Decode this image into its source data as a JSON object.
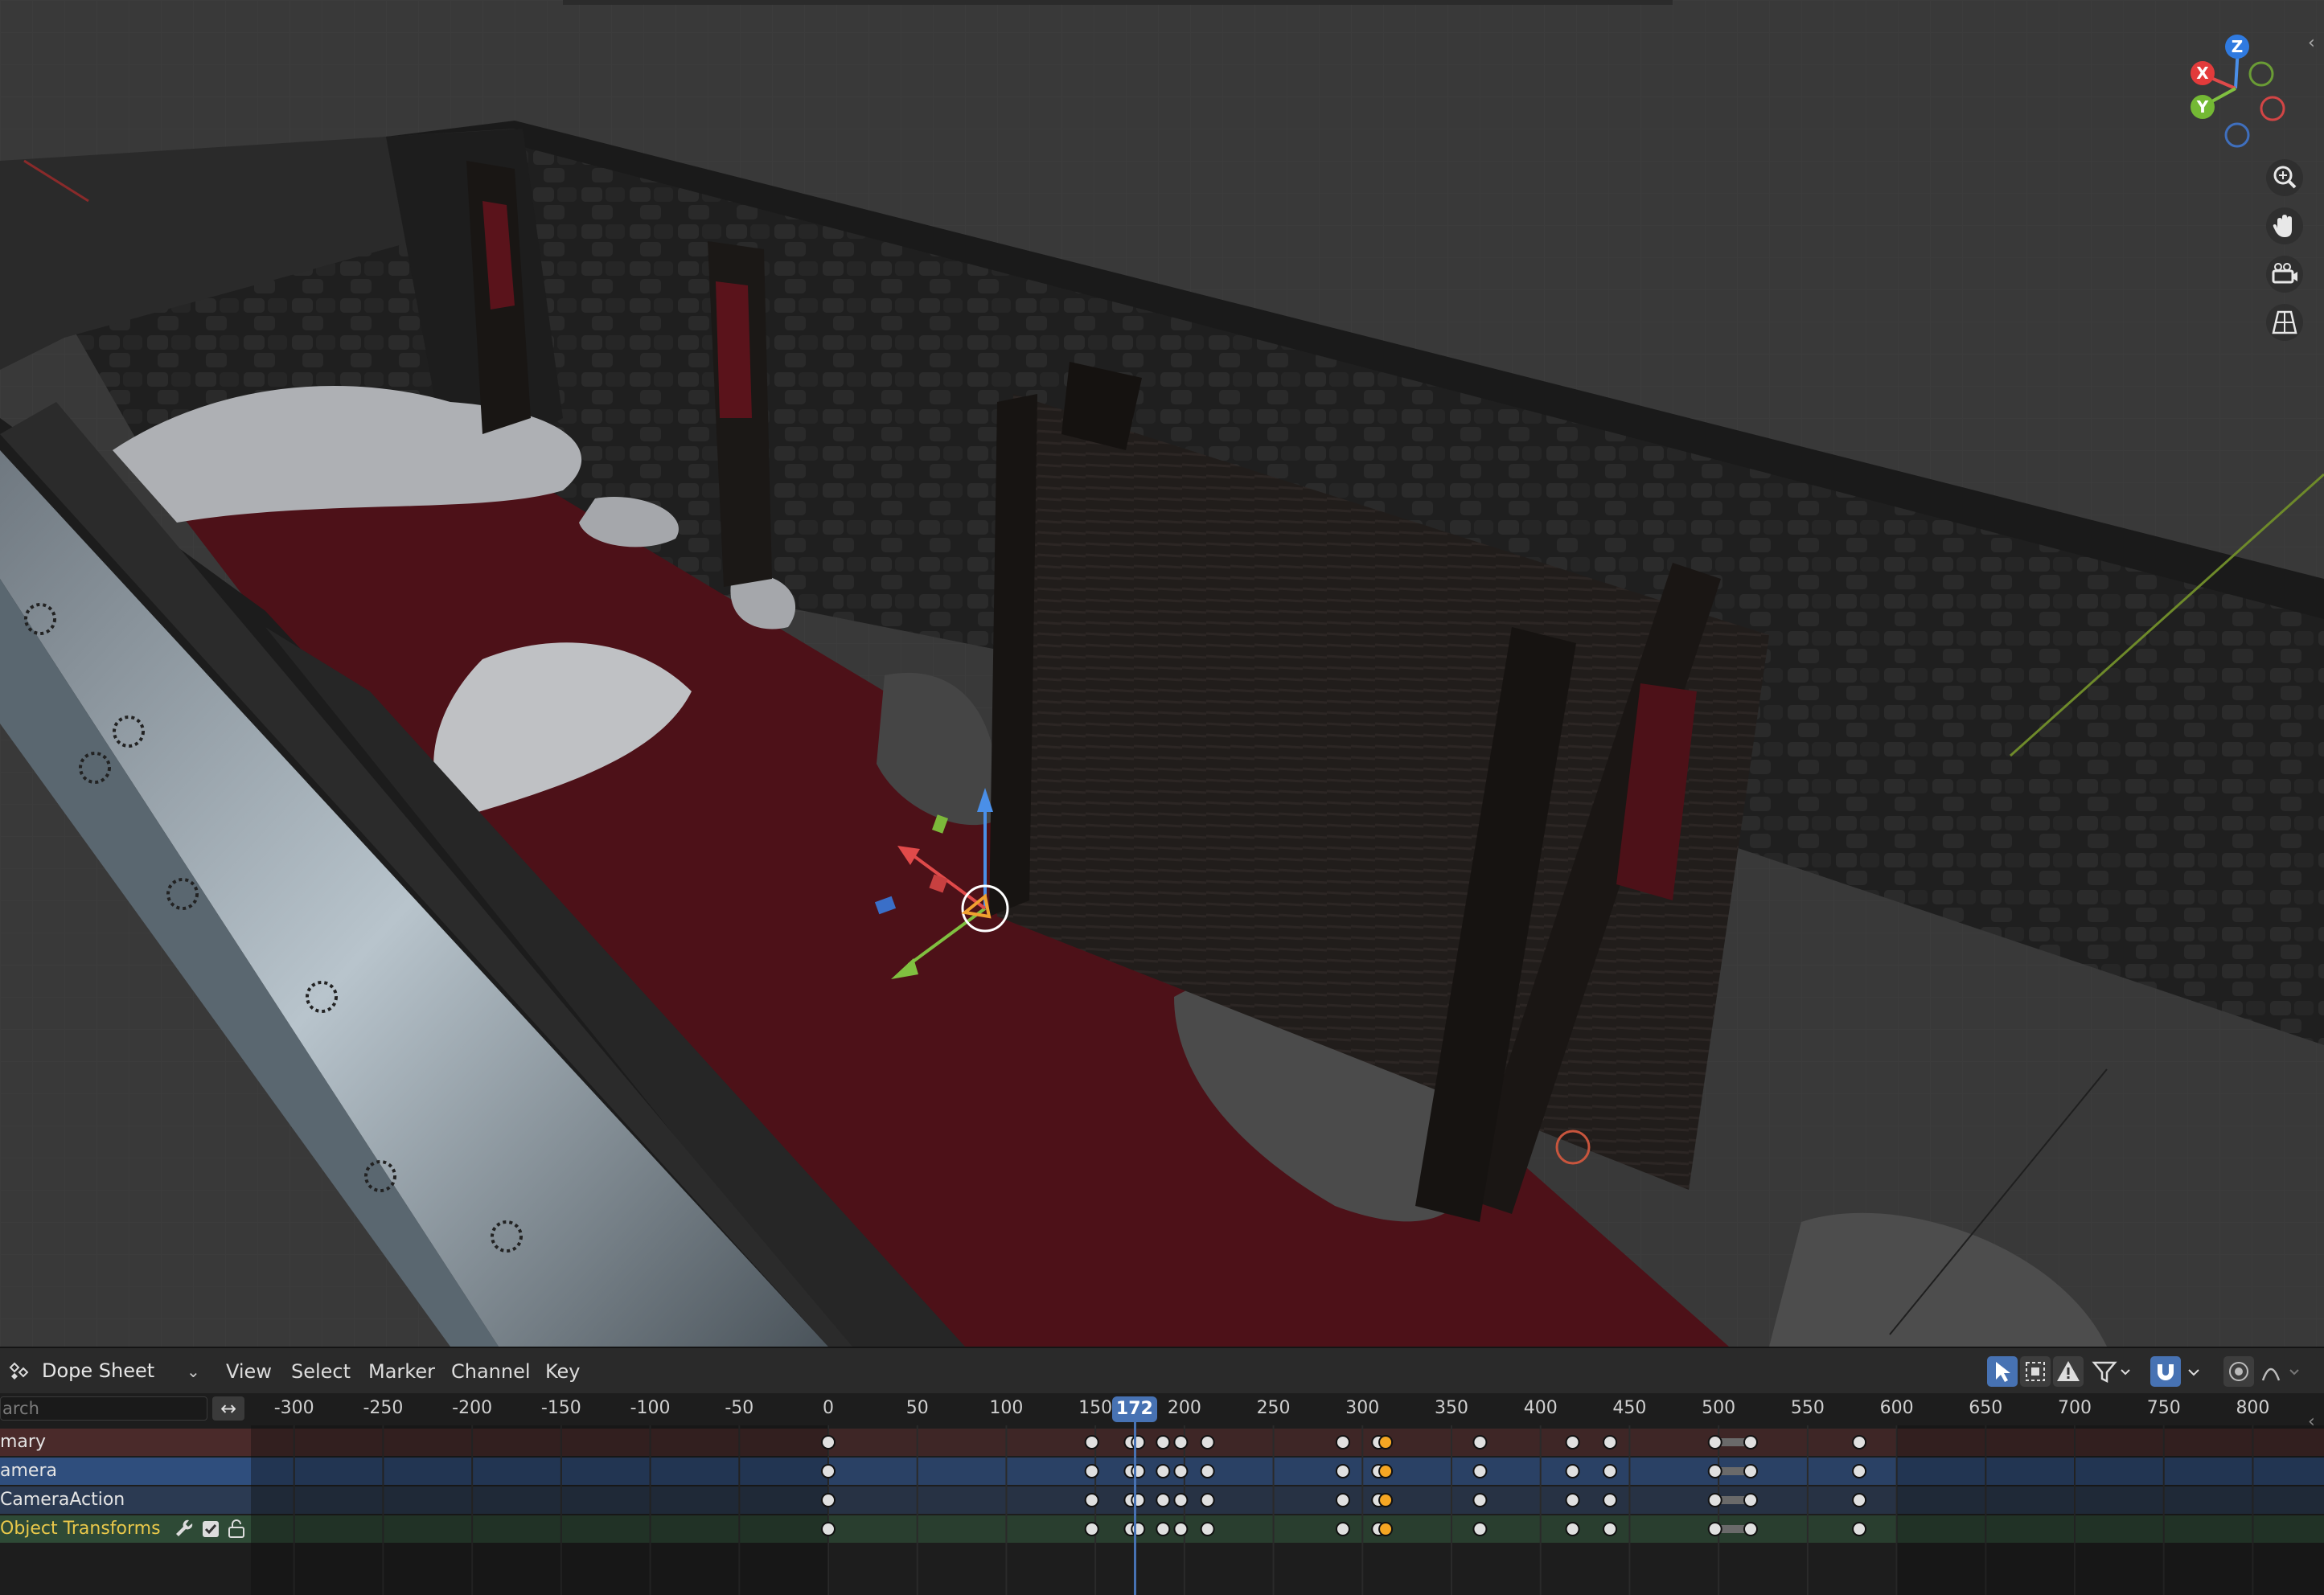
{
  "viewport": {
    "navigation_gizmo": {
      "x_label": "X",
      "y_label": "Y",
      "z_label": "Z"
    },
    "view_buttons": [
      {
        "icon": "zoom-icon"
      },
      {
        "icon": "hand-pan-icon"
      },
      {
        "icon": "camera-view-icon"
      },
      {
        "icon": "perspective-grid-icon"
      }
    ]
  },
  "dopesheet": {
    "editor_type": "Dope Sheet",
    "menus": [
      "View",
      "Select",
      "Marker",
      "Channel",
      "Key"
    ],
    "search_placeholder": "arch",
    "current_frame": "172",
    "ticks": [
      "-300",
      "-250",
      "-200",
      "-150",
      "-100",
      "-50",
      "0",
      "50",
      "100",
      "150",
      "200",
      "250",
      "300",
      "350",
      "400",
      "450",
      "500",
      "550",
      "600",
      "650",
      "700",
      "750",
      "800"
    ],
    "channels": [
      {
        "label": "mary",
        "color": "#4a2a2a"
      },
      {
        "label": "amera",
        "color": "#2f4e7d"
      },
      {
        "label": "CameraAction",
        "color": "#2b3a52"
      },
      {
        "label": "Object Transforms",
        "color": "#2e4a36",
        "text_color": "#e9c84a"
      }
    ],
    "keyframes": [
      0,
      148,
      170,
      174,
      188,
      198,
      213,
      289,
      309,
      313,
      366,
      418,
      439,
      498,
      518,
      579
    ],
    "selected_keyframes": [
      313
    ],
    "colors": {
      "accent": "#4772b3",
      "selected_key": "#f5a623",
      "key": "#e0e0e0"
    }
  }
}
